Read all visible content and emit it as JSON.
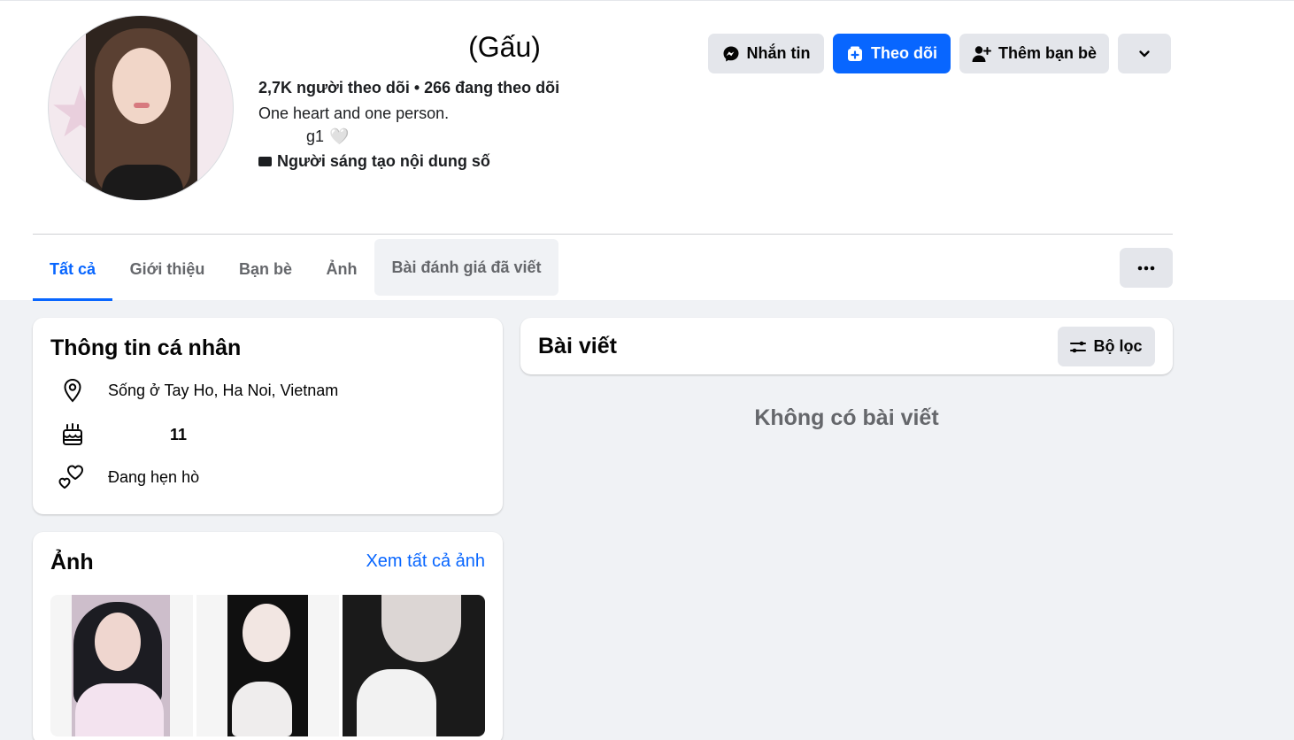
{
  "profile": {
    "name": "(Gấu)",
    "stats": "2,7K người theo dõi • 266 đang theo dõi",
    "bio_line1": "One heart and one person.",
    "bio_line2": "g1",
    "bio_heart": "🤍",
    "category": "Người sáng tạo nội dung số"
  },
  "actions": {
    "message": "Nhắn tin",
    "follow": "Theo dõi",
    "add_friend": "Thêm bạn bè",
    "accent_color": "#0866ff"
  },
  "tabs": [
    {
      "label": "Tất cả",
      "active": true
    },
    {
      "label": "Giới thiệu"
    },
    {
      "label": "Bạn bè"
    },
    {
      "label": "Ảnh"
    },
    {
      "label": "Bài đánh giá đã viết"
    }
  ],
  "tabs_more": "•••",
  "intro": {
    "title": "Thông tin cá nhân",
    "lives": "Sống ở Tay Ho, Ha Noi, Vietnam",
    "birthday": "11",
    "relationship": "Đang hẹn hò"
  },
  "photos": {
    "title": "Ảnh",
    "see_all": "Xem tất cả ảnh"
  },
  "posts": {
    "title": "Bài viết",
    "filter": "Bộ lọc",
    "empty": "Không có bài viết"
  }
}
